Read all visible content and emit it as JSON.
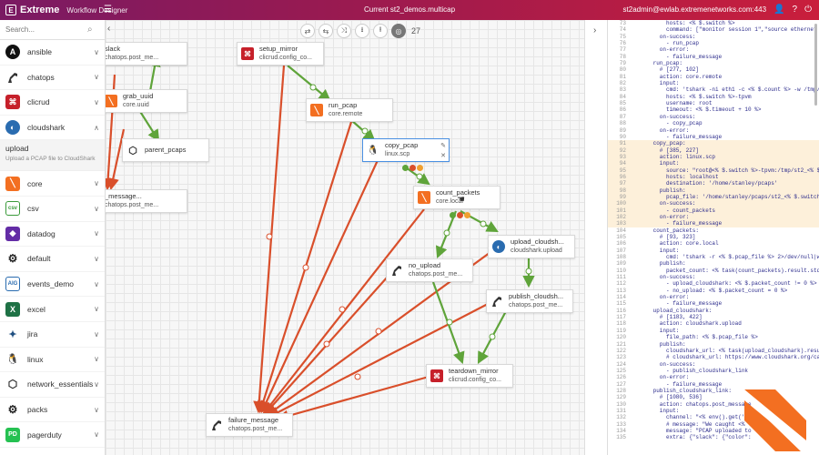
{
  "header": {
    "brand": "Extreme",
    "product": "Workflow Designer",
    "menu_icon": "hamburger-icon",
    "title": "Current st2_demos.multicap",
    "user": "st2admin@ewlab.extremenetworks.com:443"
  },
  "colors": {
    "accent_left": "#7a1a63",
    "accent_right": "#c91e3c",
    "success_edge": "#5fa43a",
    "failure_edge": "#d94f2b",
    "brand_orange": "#f36f21"
  },
  "sidebar": {
    "search_placeholder": "Search...",
    "packs": [
      {
        "name": "ansible",
        "icon": "ansible-icon"
      },
      {
        "name": "chatops",
        "icon": "robot-arm-icon"
      },
      {
        "name": "clicrud",
        "icon": "clicrud-icon"
      },
      {
        "name": "cloudshark",
        "icon": "cloudshark-icon"
      }
    ],
    "upload_action": {
      "name": "upload",
      "description": "Upload a PCAP file to CloudShark"
    },
    "packs_rest": [
      {
        "name": "core",
        "icon": "core-icon"
      },
      {
        "name": "csv",
        "icon": "csv-icon"
      },
      {
        "name": "datadog",
        "icon": "datadog-icon"
      },
      {
        "name": "default",
        "icon": "gears-icon"
      },
      {
        "name": "events_demo",
        "icon": "aig-icon"
      },
      {
        "name": "excel",
        "icon": "excel-icon"
      },
      {
        "name": "jira",
        "icon": "jira-icon"
      },
      {
        "name": "linux",
        "icon": "linux-icon"
      },
      {
        "name": "network_essentials",
        "icon": "cube-icon"
      },
      {
        "name": "packs",
        "icon": "gears-icon"
      },
      {
        "name": "pagerduty",
        "icon": "pagerduty-icon"
      }
    ]
  },
  "toolbar": {
    "count": "27"
  },
  "nodes": [
    {
      "id": "n_slack",
      "name": "slack",
      "ref": "chatops.post_me..."
    },
    {
      "id": "n_grab",
      "name": "grab_uuid",
      "ref": "core.uuid"
    },
    {
      "id": "n_parent",
      "name": "parent_pcaps",
      "ref": ""
    },
    {
      "id": "n_msg",
      "name": "_message...",
      "ref": "chatops.post_me..."
    },
    {
      "id": "n_setup",
      "name": "setup_mirror",
      "ref": "clicrud.config_co..."
    },
    {
      "id": "n_run",
      "name": "run_pcap",
      "ref": "core.remote"
    },
    {
      "id": "n_copy",
      "name": "copy_pcap",
      "ref": "linux.scp"
    },
    {
      "id": "n_count",
      "name": "count_packets",
      "ref": "core.local"
    },
    {
      "id": "n_upload",
      "name": "upload_cloudsh...",
      "ref": "cloudshark.upload"
    },
    {
      "id": "n_noupload",
      "name": "no_upload",
      "ref": "chatops.post_me..."
    },
    {
      "id": "n_publish",
      "name": "publish_cloudsh...",
      "ref": "chatops.post_me..."
    },
    {
      "id": "n_teardown",
      "name": "teardown_mirror",
      "ref": "clicrud.config_co..."
    },
    {
      "id": "n_failure",
      "name": "failure_message",
      "ref": "chatops.post_me..."
    }
  ],
  "code": {
    "lines": [
      {
        "n": "73",
        "t": "          hosts: <% $.switch %>"
      },
      {
        "n": "74",
        "t": "          command: [\"monitor session 1\",\"source ethernet 0/4 dest"
      },
      {
        "n": "75",
        "t": "        on-success:"
      },
      {
        "n": "76",
        "t": "          - run_pcap"
      },
      {
        "n": "77",
        "t": "        on-error:"
      },
      {
        "n": "78",
        "t": "          - failure_message"
      },
      {
        "n": "79",
        "t": "      run_pcap:"
      },
      {
        "n": "80",
        "t": "        # [277, 102]"
      },
      {
        "n": "81",
        "t": "        action: core.remote"
      },
      {
        "n": "82",
        "t": "        input:"
      },
      {
        "n": "83",
        "t": "          cmd: 'tshark -ni eth1 -c <% $.count %> -w /tmp/st2_<%"
      },
      {
        "n": "84",
        "t": "          hosts: <% $.switch %>-tpvm"
      },
      {
        "n": "85",
        "t": "          username: root"
      },
      {
        "n": "86",
        "t": "          timeout: <% $.timeout + 10 %>"
      },
      {
        "n": "87",
        "t": "        on-success:"
      },
      {
        "n": "88",
        "t": "          - copy_pcap"
      },
      {
        "n": "89",
        "t": "        on-error:"
      },
      {
        "n": "90",
        "t": "          - failure_message"
      },
      {
        "n": "91",
        "t": "      copy_pcap:",
        "hl": true
      },
      {
        "n": "92",
        "t": "        # [385, 227]",
        "hl": true
      },
      {
        "n": "93",
        "t": "        action: linux.scp",
        "hl": true
      },
      {
        "n": "94",
        "t": "        input:",
        "hl": true
      },
      {
        "n": "95",
        "t": "          source: \"root@<% $.switch %>-tpvm:/tmp/st2_<% $.switch",
        "hl": true
      },
      {
        "n": "96",
        "t": "          hosts: localhost",
        "hl": true
      },
      {
        "n": "97",
        "t": "          destination: '/home/stanley/pcaps'",
        "hl": true
      },
      {
        "n": "98",
        "t": "        publish:",
        "hl": true
      },
      {
        "n": "99",
        "t": "          pcap_file: '/home/stanley/pcaps/st2_<% $.switch %>_<%",
        "hl": true
      },
      {
        "n": "100",
        "t": "        on-success:",
        "hl": true
      },
      {
        "n": "101",
        "t": "          - count_packets",
        "hl": true
      },
      {
        "n": "102",
        "t": "        on-error:",
        "hl": true
      },
      {
        "n": "103",
        "t": "          - failure_message",
        "hl": true
      },
      {
        "n": "104",
        "t": "      count_packets:"
      },
      {
        "n": "105",
        "t": "        # [93, 323]"
      },
      {
        "n": "106",
        "t": "        action: core.local"
      },
      {
        "n": "107",
        "t": "        input:"
      },
      {
        "n": "108",
        "t": "          cmd: 'tshark -r <% $.pcap_file %> 2>/dev/null|wc -l'"
      },
      {
        "n": "109",
        "t": "        publish:"
      },
      {
        "n": "110",
        "t": "          packet_count: <% task(count_packets).result.stdout %>"
      },
      {
        "n": "111",
        "t": "        on-success:"
      },
      {
        "n": "112",
        "t": "          - upload_cloudshark: <% $.packet_count != 0 %>"
      },
      {
        "n": "113",
        "t": "          - no_upload: <% $.packet_count = 0 %>"
      },
      {
        "n": "114",
        "t": "        on-error:"
      },
      {
        "n": "115",
        "t": "          - failure_message"
      },
      {
        "n": "116",
        "t": "      upload_cloudshark:"
      },
      {
        "n": "117",
        "t": "        # [1183, 422]"
      },
      {
        "n": "118",
        "t": "        action: cloudshark.upload"
      },
      {
        "n": "119",
        "t": "        input:"
      },
      {
        "n": "120",
        "t": "          file_path: <% $.pcap_file %>"
      },
      {
        "n": "121",
        "t": "        publish:"
      },
      {
        "n": "122",
        "t": "          cloudshark_url: <% task(upload_cloudshark).result.result"
      },
      {
        "n": "123",
        "t": "          # cloudshark_url: https://www.cloudshark.org/captures/"
      },
      {
        "n": "124",
        "t": "        on-success:"
      },
      {
        "n": "125",
        "t": "          - publish_cloudshark_link"
      },
      {
        "n": "126",
        "t": "        on-error:"
      },
      {
        "n": "127",
        "t": "          - failure_message"
      },
      {
        "n": "128",
        "t": "      publish_cloudshark_link:"
      },
      {
        "n": "129",
        "t": "        # [1080, 536]"
      },
      {
        "n": "130",
        "t": "        action: chatops.post_message"
      },
      {
        "n": "131",
        "t": "        input:"
      },
      {
        "n": "132",
        "t": "          channel: \"<% env().get('__"
      },
      {
        "n": "133",
        "t": "          # message: \"We caught <%"
      },
      {
        "n": "134",
        "t": "          message: \"PCAP uploaded to"
      },
      {
        "n": "135",
        "t": "          extra: {\"slack\": {\"color\":"
      }
    ]
  }
}
